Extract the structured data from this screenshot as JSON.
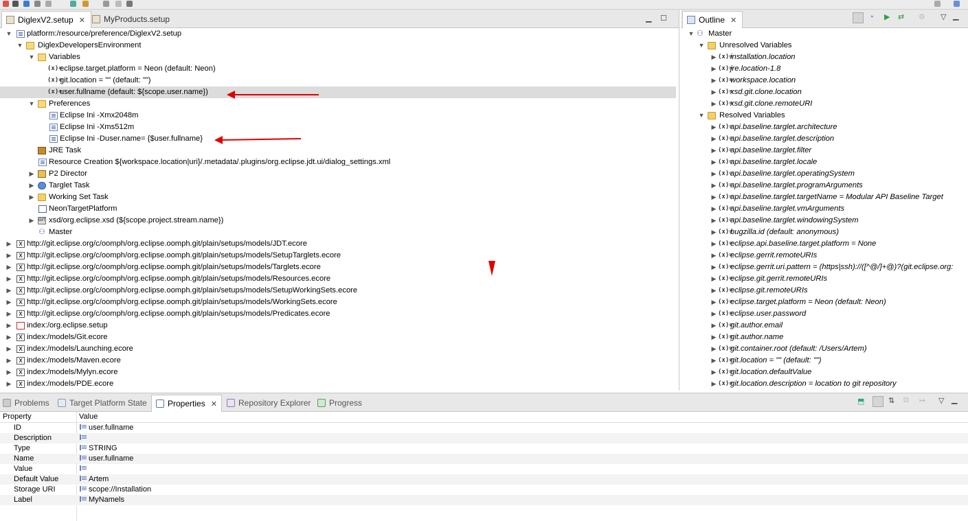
{
  "editor": {
    "tabs": [
      {
        "label": "DiglexV2.setup"
      },
      {
        "label": "MyProducts.setup"
      }
    ],
    "tree": [
      {
        "label": "platform:/resource/preference/DiglexV2.setup"
      },
      {
        "label": "DiglexDevelopersEnvironment"
      },
      {
        "label": "Variables"
      },
      {
        "label": "eclipse.target.platform = Neon (default: Neon)"
      },
      {
        "label": "git.location = \"\" (default: \"\")"
      },
      {
        "label": "user.fullname (default: ${scope.user.name})"
      },
      {
        "label": "Preferences"
      },
      {
        "label": "Eclipse Ini -Xmx2048m"
      },
      {
        "label": "Eclipse Ini -Xms512m"
      },
      {
        "label": "Eclipse Ini -Duser.name= {$user.fullname}"
      },
      {
        "label": "JRE Task"
      },
      {
        "label": "Resource Creation ${workspace.location|uri}/.metadata/.plugins/org.eclipse.jdt.ui/dialog_settings.xml"
      },
      {
        "label": "P2 Director"
      },
      {
        "label": "Targlet Task"
      },
      {
        "label": "Working Set Task"
      },
      {
        "label": "NeonTargetPlatform"
      },
      {
        "label": "xsd/org.eclipse.xsd  (${scope.project.stream.name})"
      },
      {
        "label": "Master"
      },
      {
        "label": "http://git.eclipse.org/c/oomph/org.eclipse.oomph.git/plain/setups/models/JDT.ecore"
      },
      {
        "label": "http://git.eclipse.org/c/oomph/org.eclipse.oomph.git/plain/setups/models/SetupTarglets.ecore"
      },
      {
        "label": "http://git.eclipse.org/c/oomph/org.eclipse.oomph.git/plain/setups/models/Targlets.ecore"
      },
      {
        "label": "http://git.eclipse.org/c/oomph/org.eclipse.oomph.git/plain/setups/models/Resources.ecore"
      },
      {
        "label": "http://git.eclipse.org/c/oomph/org.eclipse.oomph.git/plain/setups/models/SetupWorkingSets.ecore"
      },
      {
        "label": "http://git.eclipse.org/c/oomph/org.eclipse.oomph.git/plain/setups/models/WorkingSets.ecore"
      },
      {
        "label": "http://git.eclipse.org/c/oomph/org.eclipse.oomph.git/plain/setups/models/Predicates.ecore"
      },
      {
        "label": "index:/org.eclipse.setup"
      },
      {
        "label": "index:/models/Git.ecore"
      },
      {
        "label": "index:/models/Launching.ecore"
      },
      {
        "label": "index:/models/Maven.ecore"
      },
      {
        "label": "index:/models/Mylyn.ecore"
      },
      {
        "label": "index:/models/PDE.ecore"
      }
    ]
  },
  "outline": {
    "tab_label": "Outline",
    "tree": [
      {
        "label": "Master"
      },
      {
        "label": "Unresolved Variables"
      },
      {
        "label": "installation.location"
      },
      {
        "label": "jre.location-1.8"
      },
      {
        "label": "workspace.location"
      },
      {
        "label": "xsd.git.clone.location"
      },
      {
        "label": "xsd.git.clone.remoteURI"
      },
      {
        "label": "Resolved Variables"
      },
      {
        "label": "api.baseline.targlet.architecture"
      },
      {
        "label": "api.baseline.targlet.description"
      },
      {
        "label": "api.baseline.targlet.filter"
      },
      {
        "label": "api.baseline.targlet.locale"
      },
      {
        "label": "api.baseline.targlet.operatingSystem"
      },
      {
        "label": "api.baseline.targlet.programArguments"
      },
      {
        "label": "api.baseline.targlet.targetName = Modular API Baseline Target"
      },
      {
        "label": "api.baseline.targlet.vmArguments"
      },
      {
        "label": "api.baseline.targlet.windowingSystem"
      },
      {
        "label": "bugzilla.id (default: anonymous)"
      },
      {
        "label": "eclipse.api.baseline.target.platform = None"
      },
      {
        "label": "eclipse.gerrit.remoteURIs"
      },
      {
        "label": "eclipse.gerrit.uri.pattern = (https|ssh)://([^@/]+@)?(git.eclipse.org:"
      },
      {
        "label": "eclipse.git.gerrit.remoteURIs"
      },
      {
        "label": "eclipse.git.remoteURIs"
      },
      {
        "label": "eclipse.target.platform = Neon (default: Neon)"
      },
      {
        "label": "eclipse.user.password"
      },
      {
        "label": "git.author.email"
      },
      {
        "label": "git.author.name"
      },
      {
        "label": "git.container.root (default: /Users/Artem)"
      },
      {
        "label": "git.location = \"\" (default: \"\")"
      },
      {
        "label": "git.location.defaultValue"
      },
      {
        "label": "git.location.description = location to git repository"
      }
    ]
  },
  "bottom": {
    "tabs": [
      {
        "label": "Problems"
      },
      {
        "label": "Target Platform State"
      },
      {
        "label": "Properties"
      },
      {
        "label": "Repository Explorer"
      },
      {
        "label": "Progress"
      }
    ],
    "columns": {
      "property": "Property",
      "value": "Value"
    },
    "rows": [
      {
        "property": "ID",
        "value": "user.fullname"
      },
      {
        "property": "Description",
        "value": ""
      },
      {
        "property": "Type",
        "value": "STRING"
      },
      {
        "property": "Name",
        "value": "user.fullname"
      },
      {
        "property": "Value",
        "value": ""
      },
      {
        "property": "Default Value",
        "value": "Artem"
      },
      {
        "property": "Storage URI",
        "value": "scope://Installation"
      },
      {
        "property": "Label",
        "value": "MyNamels"
      }
    ]
  },
  "icons": {
    "variable": "(x)=",
    "close": "✕"
  },
  "colors": {
    "selection": "#dcdcdc",
    "annotation_arrow": "#e00000"
  }
}
